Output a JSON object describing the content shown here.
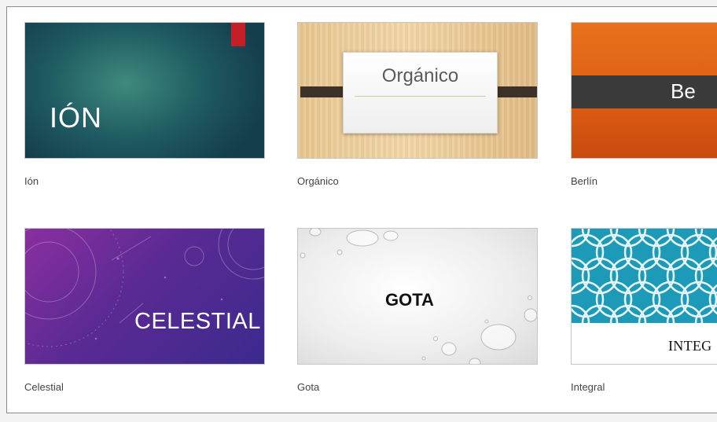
{
  "themes": [
    {
      "label": "Ión",
      "thumb_title": "IÓN"
    },
    {
      "label": "Orgánico",
      "thumb_title": "Orgánico"
    },
    {
      "label": "Berlín",
      "thumb_title": "Be"
    },
    {
      "label": "Celestial",
      "thumb_title": "CELESTIAL"
    },
    {
      "label": "Gota",
      "thumb_title": "GOTA"
    },
    {
      "label": "Integral",
      "thumb_title": "INTEG"
    }
  ],
  "colors": {
    "ion_bg": "#1f5a62",
    "ion_accent": "#c41f26",
    "organico_bg": "#f3d7a7",
    "berlin_bg": "#df5e14",
    "celestial_bg": "#5a2a93",
    "gota_bg": "#ededed",
    "integral_pattern": "#1c9ab8"
  }
}
